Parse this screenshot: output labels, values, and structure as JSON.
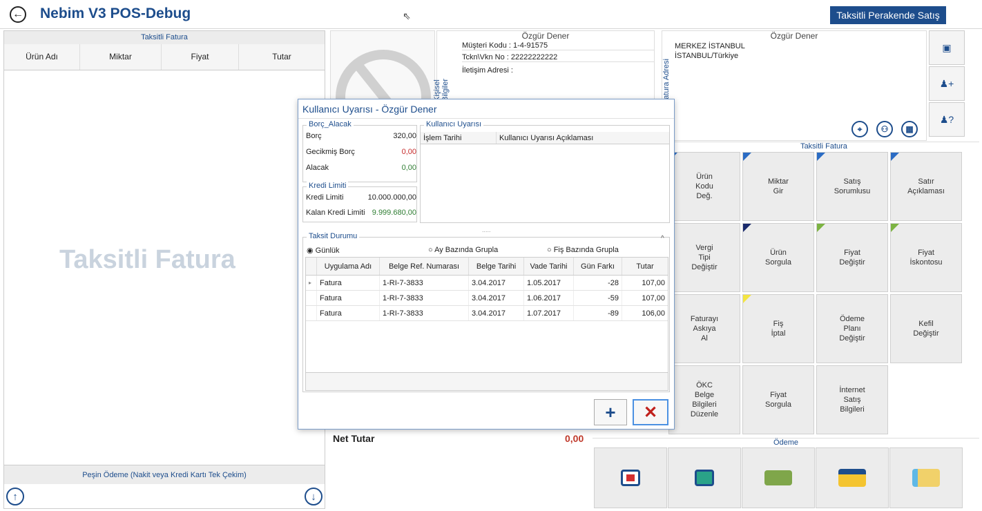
{
  "app": {
    "title": "Nebim V3 POS-Debug",
    "mode_button": "Taksitli Perakende Satış"
  },
  "left_panel": {
    "title": "Taksitli Fatura",
    "columns": [
      "Ürün Adı",
      "Miktar",
      "Fiyat",
      "Tutar"
    ],
    "watermark": "Taksitli Fatura",
    "cash_payment": "Peşin Ödeme (Nakit veya Kredi Kartı Tek Çekim)"
  },
  "customer": {
    "name": "Özgür Dener",
    "code": "Müşteri Kodu : 1-4-91575",
    "tax_no": "Tckn\\Vkn No  : 22222222222",
    "address_label": "İletişim Adresi :",
    "side_label": "Kişisel Bilgiler"
  },
  "address": {
    "name": "Özgür Dener",
    "line1": "MERKEZ  İSTANBUL",
    "line2": "İSTANBUL/Türkiye",
    "side_label": "Fatura Adresi"
  },
  "functions": {
    "title": "Taksitli Fatura",
    "buttons": [
      "Ürün\nKodu\nDeğ.",
      "Miktar\nGir",
      "Satış\nSorumlusu",
      "Satır\nAçıklaması",
      "Vergi\nTipi\nDeğiştir",
      "Ürün\nSorgula",
      "Fiyat\nDeğiştir",
      "Fiyat\nİskontosu",
      "Faturayı\nAskıya\nAl",
      "Fiş\nİptal",
      "Ödeme\nPlanı\nDeğiştir",
      "Kefil\nDeğiştir",
      "ÖKC\nBelge\nBilgileri\nDüzenle",
      "Fiyat\nSorgula",
      "İnternet\nSatış\nBilgileri"
    ]
  },
  "totals": {
    "net_label": "Net Tutar",
    "net_value": "0,00",
    "payment_title": "Ödeme"
  },
  "dialog": {
    "title": "Kullanıcı Uyarısı - Özgür Dener",
    "borc_group": "Borç_Alacak",
    "borc_label": "Borç",
    "borc_value": "320,00",
    "gecikmis_label": "Gecikmiş Borç",
    "gecikmis_value": "0,00",
    "alacak_label": "Alacak",
    "alacak_value": "0,00",
    "kredi_group": "Kredi Limiti",
    "kredi_label": "Kredi Limiti",
    "kredi_value": "10.000.000,00",
    "kalan_label": "Kalan Kredi Limiti",
    "kalan_value": "9.999.680,00",
    "warn_group": "Kullanıcı Uyarısı",
    "warn_columns": [
      "İşlem Tarihi",
      "Kullanıcı Uyarısı Açıklaması"
    ],
    "taksit_group": "Taksit Durumu",
    "radio_daily": "Günlük",
    "radio_month": "Ay Bazında Grupla",
    "radio_receipt": "Fiş Bazında Grupla",
    "table_columns": [
      "Uygulama Adı",
      "Belge Ref. Numarası",
      "Belge Tarihi",
      "Vade Tarihi",
      "Gün Farkı",
      "Tutar"
    ],
    "rows": [
      [
        "Fatura",
        "1-RI-7-3833",
        "3.04.2017",
        "1.05.2017",
        "-28",
        "107,00"
      ],
      [
        "Fatura",
        "1-RI-7-3833",
        "3.04.2017",
        "1.06.2017",
        "-59",
        "107,00"
      ],
      [
        "Fatura",
        "1-RI-7-3833",
        "3.04.2017",
        "1.07.2017",
        "-89",
        "106,00"
      ]
    ]
  }
}
